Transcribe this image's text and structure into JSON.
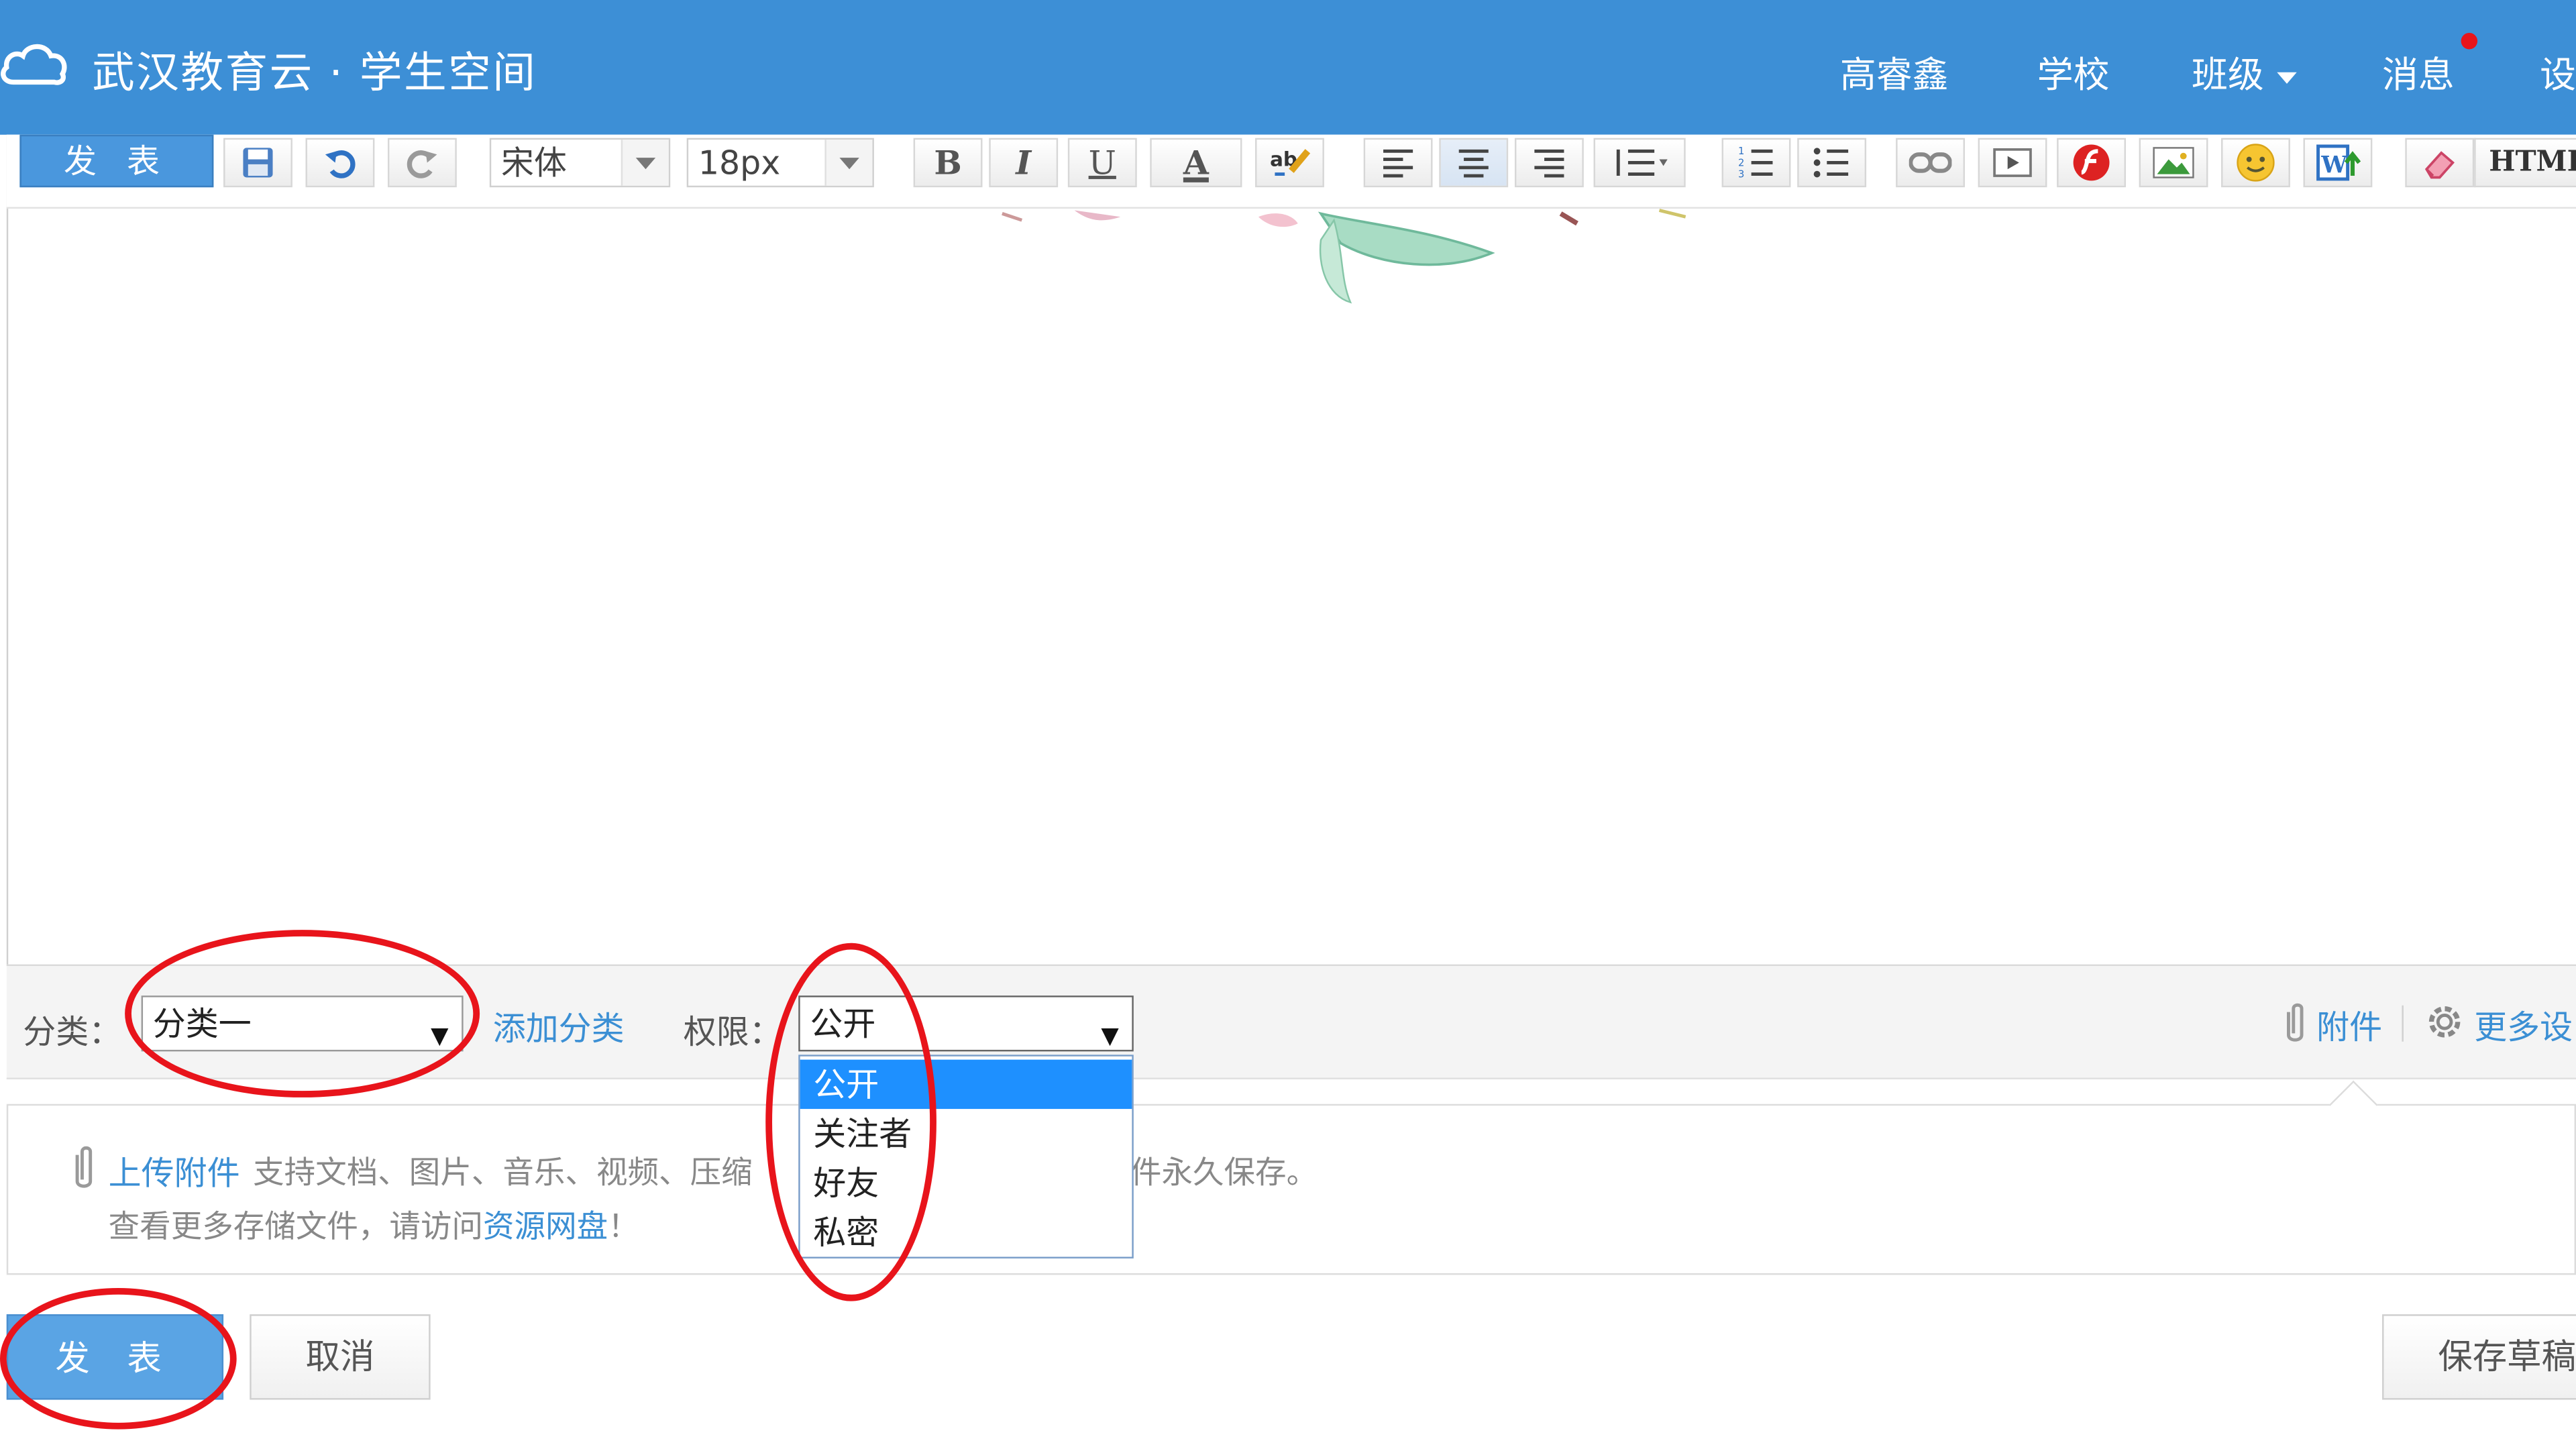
{
  "header": {
    "title": "武汉教育云 · 学生空间",
    "nav": [
      "高睿鑫",
      "学校",
      "班级",
      "消息",
      "设"
    ],
    "bg_color": "#3d8fd6",
    "notification_dot_color": "#e8141b"
  },
  "toolbar": {
    "publish_label": "发 表",
    "font_family": "宋体",
    "font_size": "18px",
    "bold": "B",
    "italic": "I",
    "underline": "U",
    "font_color": "A",
    "html_label": "HTML",
    "icons": [
      "save-icon",
      "undo-icon",
      "redo-icon",
      "bold-icon",
      "italic-icon",
      "underline-icon",
      "font-color-icon",
      "spellcheck-icon",
      "align-left-icon",
      "align-center-icon",
      "align-right-icon",
      "line-height-icon",
      "ordered-list-icon",
      "unordered-list-icon",
      "link-icon",
      "video-icon",
      "flash-icon",
      "image-icon",
      "emoticon-icon",
      "word-import-icon",
      "eraser-icon"
    ]
  },
  "meta": {
    "category_label": "分类：",
    "category_value": "分类一",
    "add_category": "添加分类",
    "permission_label": "权限：",
    "permission_value": "公开",
    "permission_options": [
      "公开",
      "关注者",
      "好友",
      "私密"
    ],
    "attachment_link": "附件",
    "more_settings": "更多设"
  },
  "attach": {
    "upload_link": "上传附件",
    "desc_a": "支持文档、图片、音乐、视频、压缩",
    "desc_b": "件永久保存。",
    "line2_prefix": "查看更多存储文件，请访问",
    "line2_link": "资源网盘",
    "line2_suffix": "！"
  },
  "actions": {
    "publish": "发 表",
    "cancel": "取消",
    "save_draft": "保存草稿"
  },
  "annotation_color": "#e8141b"
}
